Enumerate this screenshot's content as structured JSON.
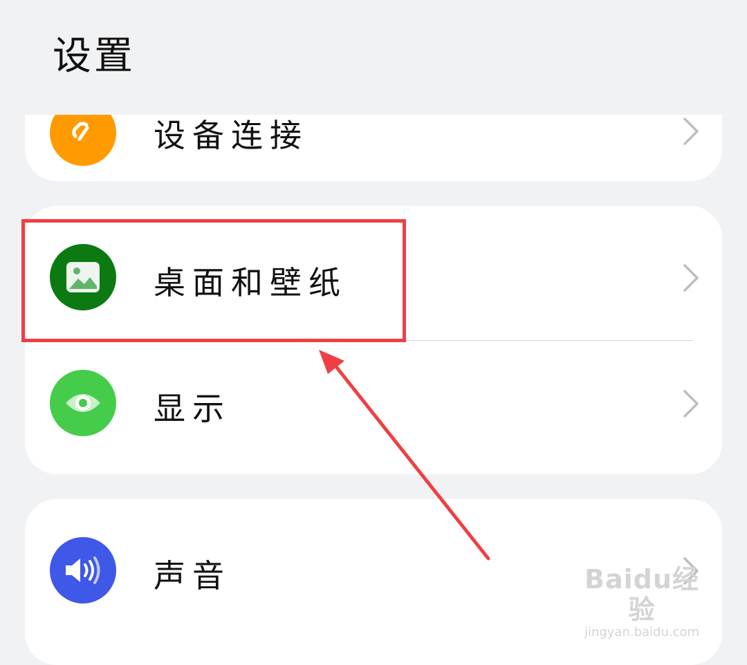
{
  "header": {
    "title": "设置"
  },
  "groups": [
    {
      "items": [
        {
          "label": "设备连接",
          "icon": "link-icon",
          "icon_bg": "#ff9b00"
        }
      ]
    },
    {
      "items": [
        {
          "label": "桌面和壁纸",
          "icon": "image-icon",
          "icon_bg": "#0b7a12",
          "highlighted": true
        },
        {
          "label": "显示",
          "icon": "eye-icon",
          "icon_bg": "#44cc4a"
        }
      ]
    },
    {
      "items": [
        {
          "label": "声音",
          "icon": "speaker-icon",
          "icon_bg": "#3f58e8"
        }
      ]
    }
  ],
  "annotation": {
    "box_color": "#ef3f43",
    "arrow_color": "#ef3f43"
  },
  "watermark": {
    "logo": "Baidu经验",
    "url": "jingyan.baidu.com"
  }
}
